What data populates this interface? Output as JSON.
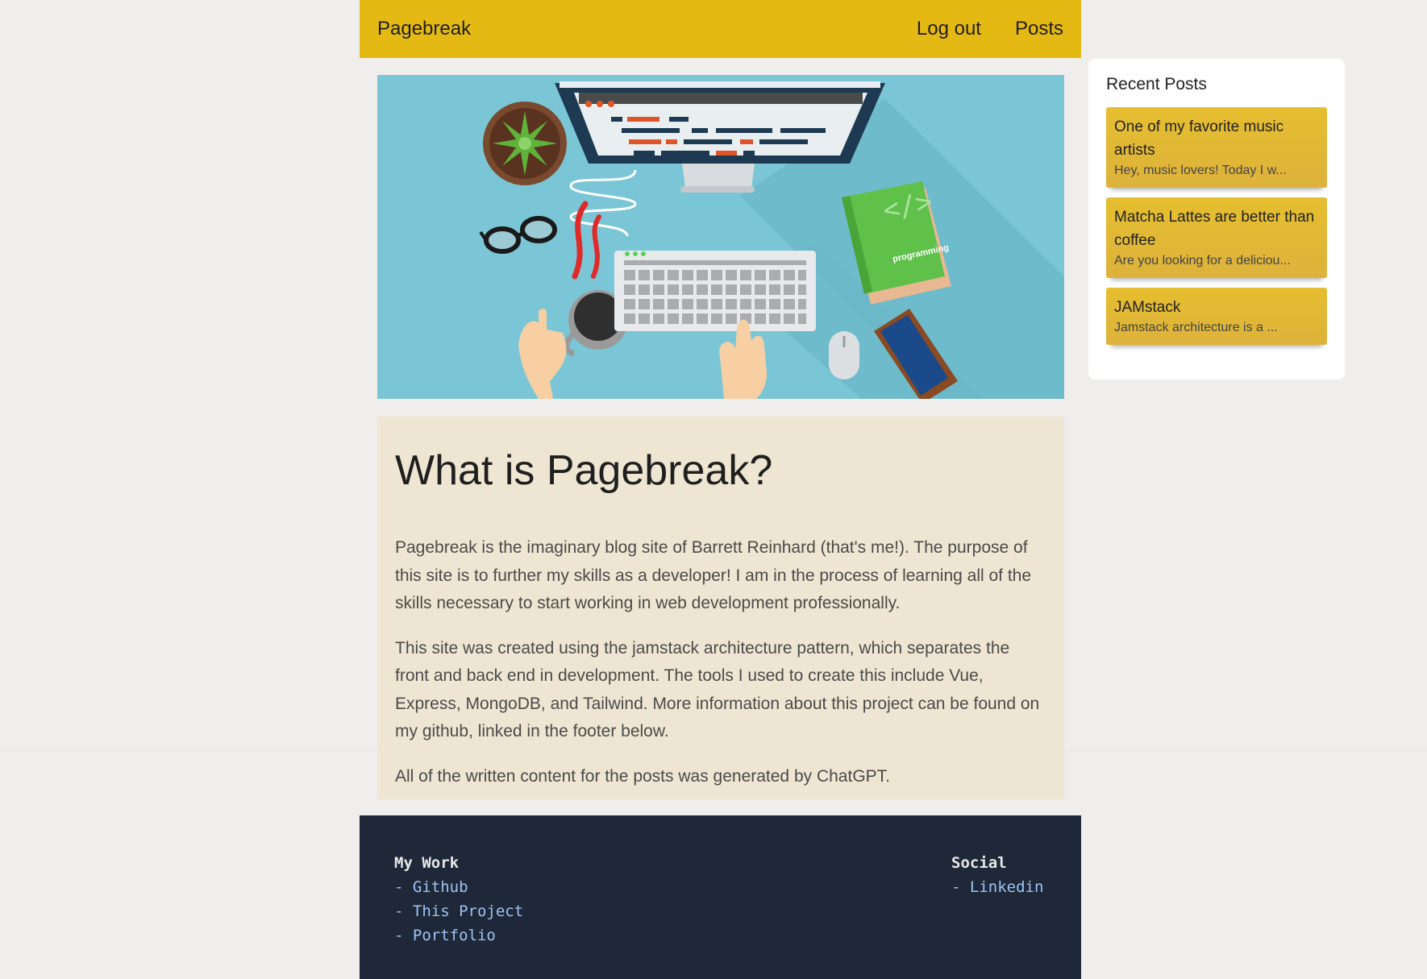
{
  "header": {
    "brand": "Pagebreak",
    "nav": [
      "Log out",
      "Posts"
    ],
    "background": "#e5b913"
  },
  "hero": {
    "description_icons": [
      "monitor-icon",
      "keyboard-icon",
      "coffee-cup-icon",
      "glasses-icon",
      "plant-icon",
      "book-icon",
      "phone-icon",
      "mouse-icon"
    ],
    "book_label": "programming"
  },
  "article": {
    "title": "What is Pagebreak?",
    "paragraphs": [
      "Pagebreak is the imaginary blog site of Barrett Reinhard (that's me!). The purpose of this site is to further my skills as a developer! I am in the process of learning all of the skills necessary to start working in web development professionally.",
      "This site was created using the jamstack architecture pattern, which separates the front and back end in development. The tools I used to create this include Vue, Express, MongoDB, and Tailwind. More information about this project can be found on my github, linked in the footer below.",
      "All of the written content for the posts was generated by ChatGPT."
    ]
  },
  "sidebar": {
    "title": "Recent Posts",
    "posts": [
      {
        "title": "One of my favorite music artists",
        "excerpt": "Hey, music lovers! Today I w..."
      },
      {
        "title": "Matcha Lattes are better than coffee",
        "excerpt": "Are you looking for a deliciou..."
      },
      {
        "title": "JAMstack",
        "excerpt": "Jamstack architecture is a ..."
      }
    ]
  },
  "footer": {
    "work_title": "My Work",
    "work_links": [
      "- Github",
      "- This Project",
      "- Portfolio"
    ],
    "social_title": "Social",
    "social_links": [
      "- Linkedin"
    ]
  }
}
